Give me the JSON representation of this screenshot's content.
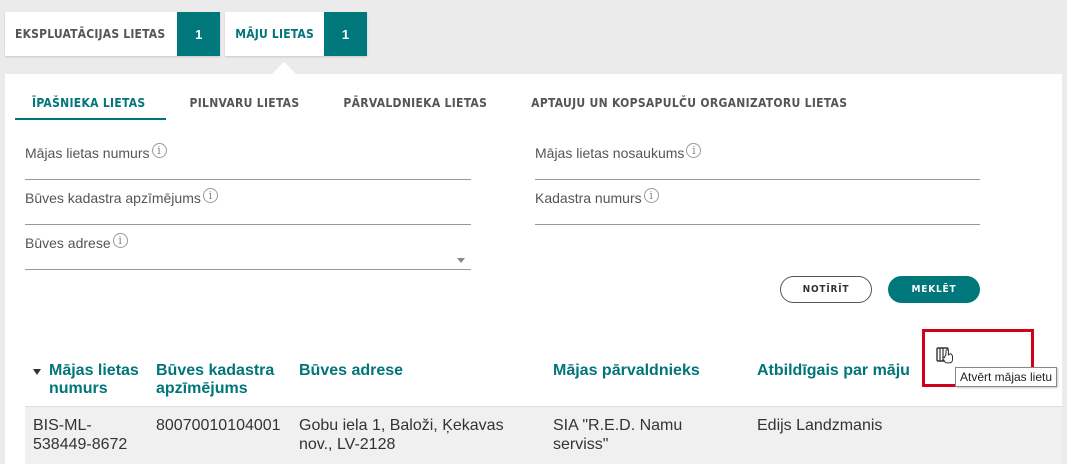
{
  "top_tabs": [
    {
      "label": "EKSPLUATĀCIJAS LIETAS",
      "count": "1"
    },
    {
      "label": "MĀJU LIETAS",
      "count": "1"
    }
  ],
  "sub_tabs": [
    {
      "label": "ĪPAŠNIEKA LIETAS"
    },
    {
      "label": "PILNVARU LIETAS"
    },
    {
      "label": "PĀRVALDNIEKA LIETAS"
    },
    {
      "label": "APTAUJU UN KOPSAPULČU ORGANIZATORU LIETAS"
    }
  ],
  "form": {
    "house_case_number": "Mājas lietas numurs",
    "house_case_name": "Mājas lietas nosaukums",
    "building_cadastre": "Būves kadastra apzīmējums",
    "cadastre_number": "Kadastra numurs",
    "building_address": "Būves adrese",
    "info_glyph": "i"
  },
  "buttons": {
    "clear": "NOTĪRĪT",
    "search": "MEKLĒT"
  },
  "table": {
    "headers": [
      "Mājas lietas numurs",
      "Būves kadastra apzīmējums",
      "Būves adrese",
      "Mājas pārvaldnieks",
      "Atbildīgais par māju"
    ],
    "rows": [
      {
        "number": "BIS-ML-538449-8672",
        "cadastre": "80070010104001",
        "address": "Gobu iela 1, Baloži, Ķekavas nov., LV-2128",
        "manager": "SIA \"R.E.D. Namu serviss\"",
        "responsible": "Edijs Landzmanis"
      }
    ]
  },
  "tooltip": "Atvērt mājas lietu",
  "colors": {
    "accent": "#00777b",
    "highlight": "#d0021b"
  }
}
